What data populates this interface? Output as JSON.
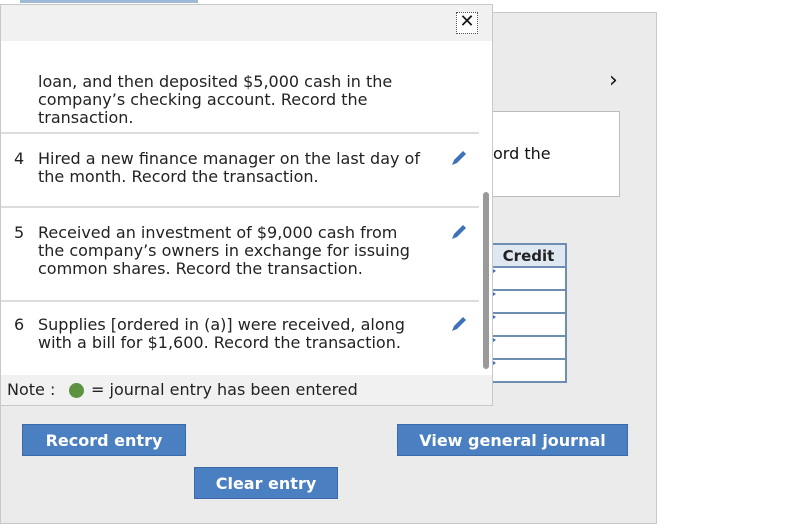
{
  "page": {
    "nav_arrow": "›",
    "desc_partial": "ord the",
    "table": {
      "header": "Credit",
      "row_count": 5
    },
    "buttons": {
      "record": "Record entry",
      "view": "View general journal",
      "clear": "Clear entry"
    }
  },
  "popup": {
    "close_glyph": "✕",
    "items": [
      {
        "num": "",
        "text": "loan, and then deposited $5,000 cash in the company’s checking account. Record the transaction.",
        "edit": false
      },
      {
        "num": "4",
        "text": "Hired a new finance manager on the last day of the month. Record the transaction.",
        "edit": true
      },
      {
        "num": "5",
        "text": "Received an investment of $9,000 cash from the company’s owners in exchange for issuing common shares. Record the transaction.",
        "edit": true
      },
      {
        "num": "6",
        "text": "Supplies [ordered in (a)] were received, along with a bill for $1,600. Record the transaction.",
        "edit": true
      }
    ],
    "note_prefix": "Note :",
    "note_suffix": "= journal entry has been entered",
    "colors": {
      "pencil": "#3d71b8",
      "entered_dot": "#5d9340"
    }
  }
}
